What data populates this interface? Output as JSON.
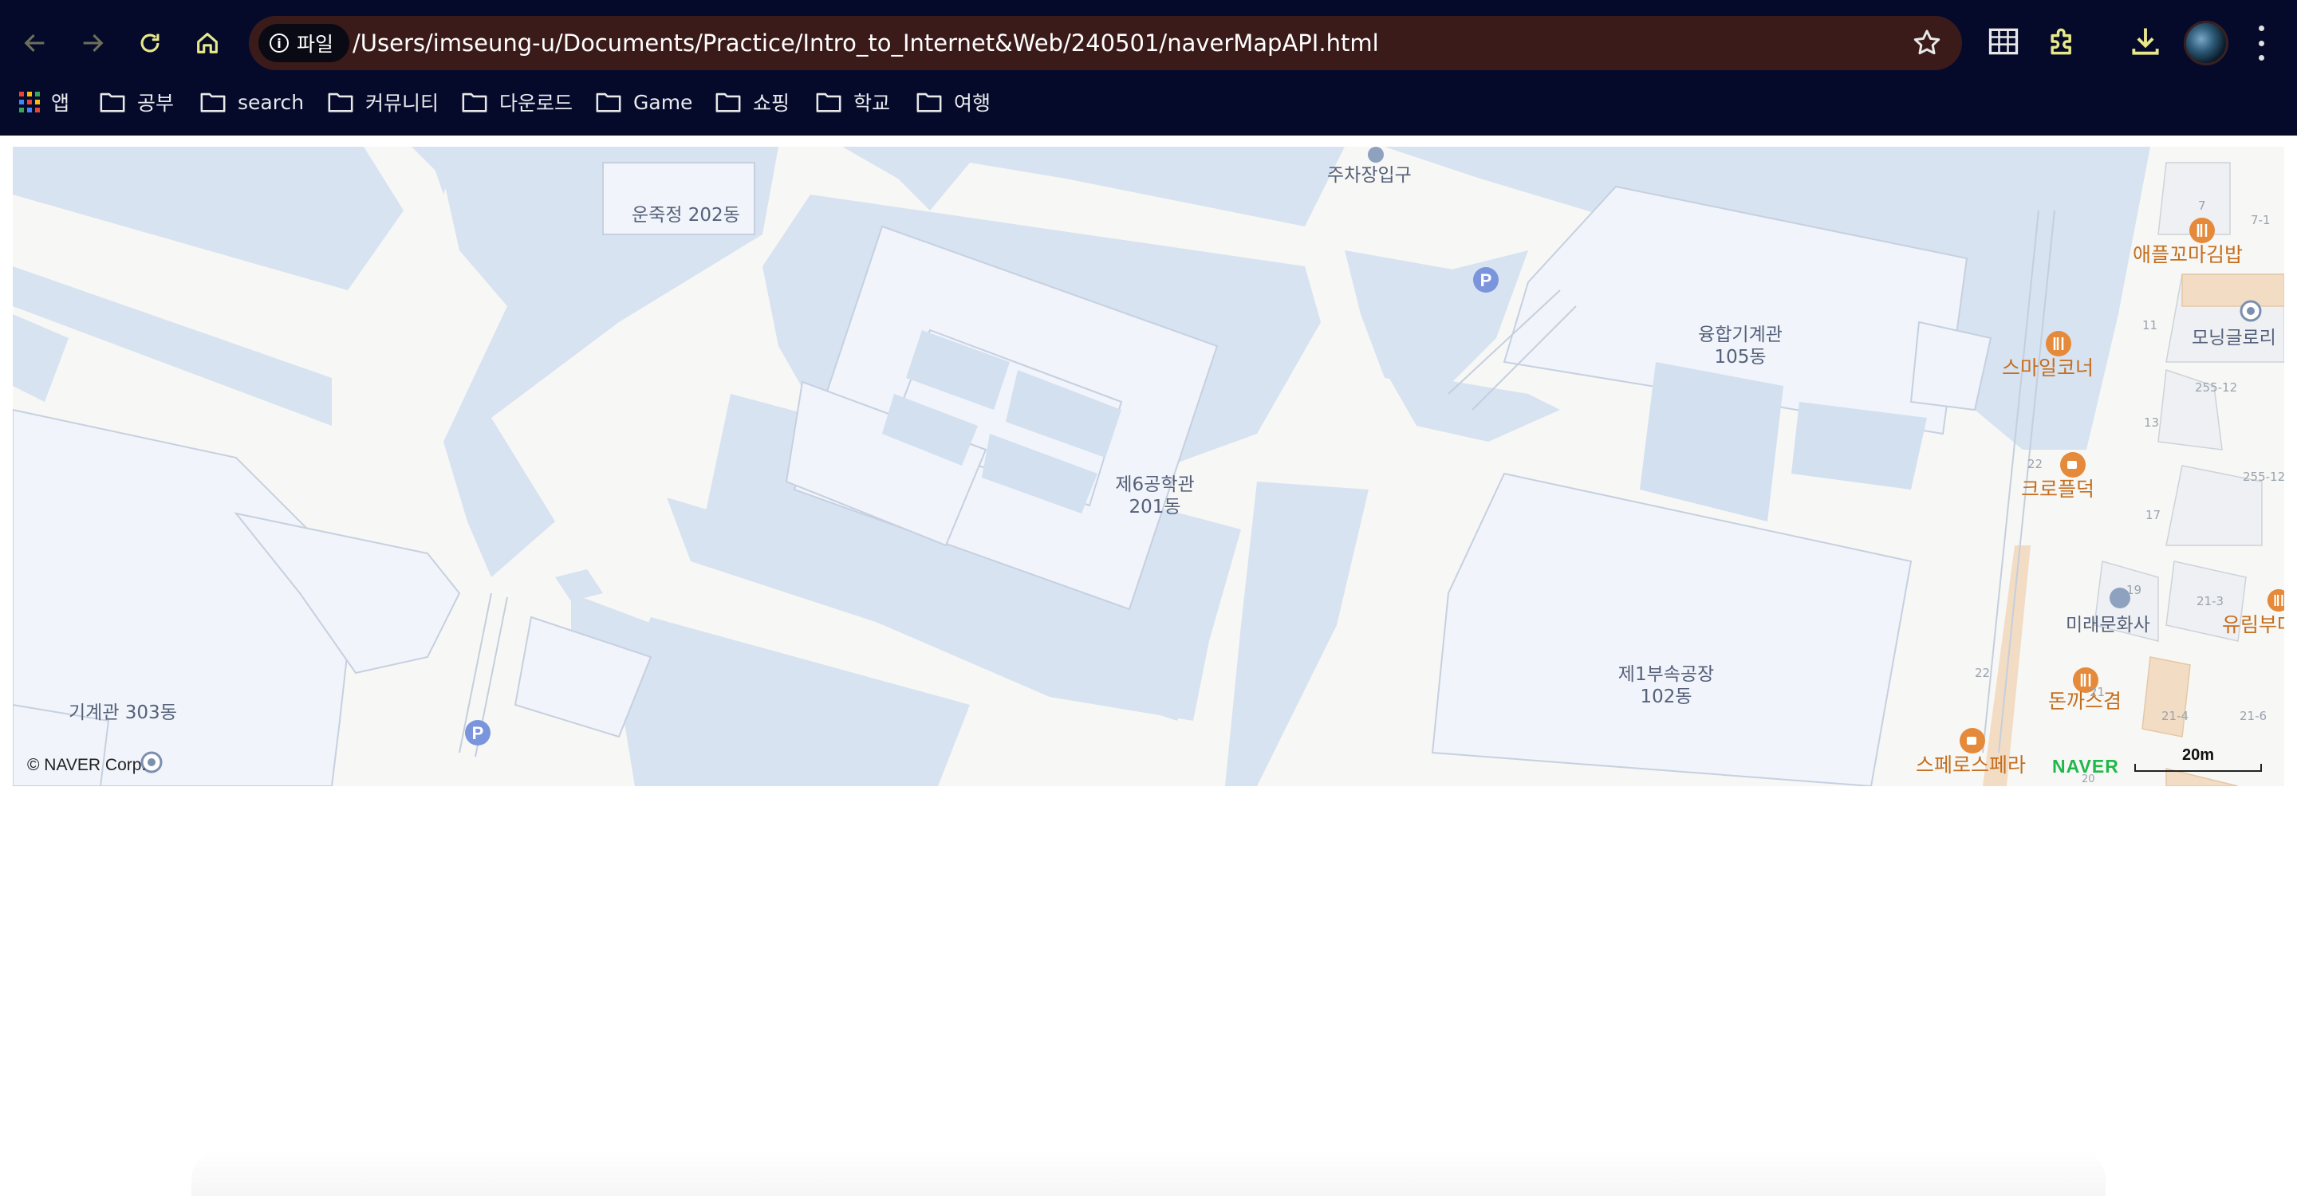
{
  "browser": {
    "omnibox": {
      "chip_label": "파일",
      "url": "/Users/imseung-u/Documents/Practice/Intro_to_Internet&Web/240501/naverMapAPI.html"
    },
    "bookmarks": [
      {
        "label": "앱",
        "icon": "apps-grid-icon"
      },
      {
        "label": "공부",
        "icon": "folder-icon"
      },
      {
        "label": "search",
        "icon": "folder-icon"
      },
      {
        "label": "커뮤니티",
        "icon": "folder-icon"
      },
      {
        "label": "다운로드",
        "icon": "folder-icon"
      },
      {
        "label": "Game",
        "icon": "folder-icon"
      },
      {
        "label": "쇼핑",
        "icon": "folder-icon"
      },
      {
        "label": "학교",
        "icon": "folder-icon"
      },
      {
        "label": "여행",
        "icon": "folder-icon"
      }
    ],
    "colors": {
      "chrome_bg": "#050a2b",
      "omnibox_bg": "#3b1b1a",
      "nav_icon": "#e8e88a"
    }
  },
  "map": {
    "labels": {
      "parking_entrance": "주차장입구",
      "unjukjeong": "운죽정 202동",
      "building_105_name": "융합기계관",
      "building_105_num": "105동",
      "building_201_name": "제6공학관",
      "building_201_num": "201동",
      "building_102_name": "제1부속공장",
      "building_102_num": "102동",
      "building_303": "기계관 303동",
      "mirae": "미래문화사",
      "morning": "모닝글로리"
    },
    "pois": {
      "kimbap": "애플꼬마김밥",
      "smile": "스마일코너",
      "croffle": "크로플덕",
      "tonkatsu": "돈까스겸",
      "yurim": "유림부대",
      "espresso": "스페로스페라"
    },
    "lot_numbers": [
      "7",
      "7-1",
      "11",
      "255-12",
      "13",
      "255-12",
      "22",
      "17",
      "19",
      "21-3",
      "21",
      "21-4",
      "21-6",
      "22",
      "20"
    ],
    "credit": "© NAVER Corp.",
    "brand": "NAVER",
    "scale_label": "20m",
    "colors": {
      "water_roof": "#d7e3f1",
      "road": "#f7f7f5",
      "building": "#f1f4fa",
      "poi": "#c46e1e",
      "brand": "#1fb84a"
    }
  }
}
